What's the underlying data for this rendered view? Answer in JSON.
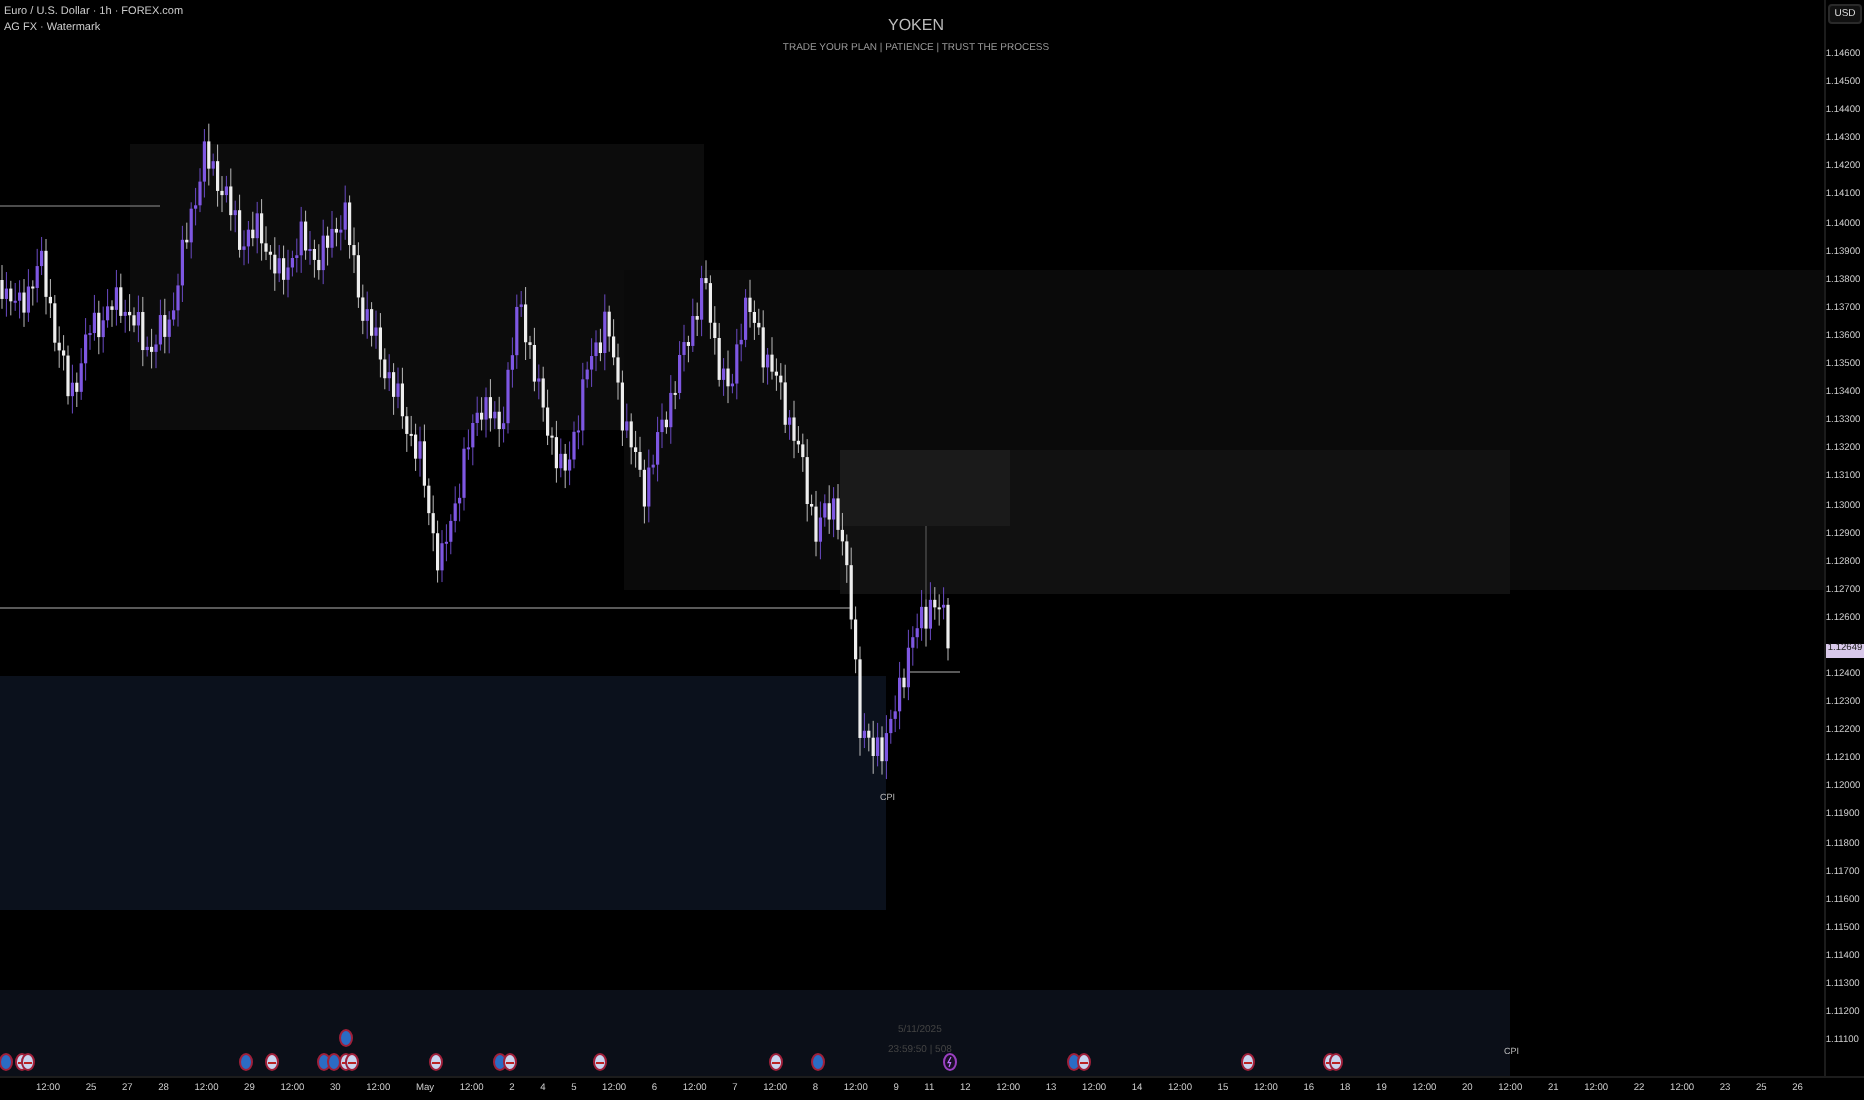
{
  "legend": {
    "symbol": "Euro / U.S. Dollar · 1h · FOREX.com",
    "indicator": "AG FX · Watermark"
  },
  "watermark": {
    "title": "YOKEN",
    "subtitle": "TRADE YOUR PLAN | PATIENCE | TRUST THE PROCESS"
  },
  "currency_button": "USD",
  "price_axis": [
    {
      "text": "1.14600",
      "kind": "tick"
    },
    {
      "text": "1.14500",
      "kind": "tick"
    },
    {
      "text": "1.14400",
      "kind": "tick"
    },
    {
      "text": "1.14300",
      "kind": "tick"
    },
    {
      "text": "1.14200",
      "kind": "tick"
    },
    {
      "text": "1.14100",
      "kind": "tick"
    },
    {
      "text": "1.14000",
      "kind": "tick"
    },
    {
      "text": "1.13900",
      "kind": "tick"
    },
    {
      "text": "1.13800",
      "kind": "tick"
    },
    {
      "text": "1.13700",
      "kind": "tick"
    },
    {
      "text": "1.13600",
      "kind": "tick"
    },
    {
      "text": "1.13500",
      "kind": "tick"
    },
    {
      "text": "1.13400",
      "kind": "tick"
    },
    {
      "text": "1.13300",
      "kind": "tick"
    },
    {
      "text": "1.13200",
      "kind": "tick"
    },
    {
      "text": "1.13100",
      "kind": "tick"
    },
    {
      "text": "1.13000",
      "kind": "tick"
    },
    {
      "text": "1.12900",
      "kind": "tick"
    },
    {
      "text": "1.12800",
      "kind": "tick"
    },
    {
      "text": "1.12700",
      "kind": "tick"
    },
    {
      "text": "1.12600",
      "kind": "tick"
    },
    {
      "text": "1.12649",
      "kind": "current"
    },
    {
      "text": "1.12400",
      "kind": "tick"
    },
    {
      "text": "1.12300",
      "kind": "tick"
    },
    {
      "text": "1.12200",
      "kind": "tick"
    },
    {
      "text": "1.12100",
      "kind": "tick"
    },
    {
      "text": "1.12000",
      "kind": "tick"
    },
    {
      "text": "1.11900",
      "kind": "tick"
    },
    {
      "text": "1.11800",
      "kind": "tick"
    },
    {
      "text": "1.11700",
      "kind": "tick"
    },
    {
      "text": "1.11600",
      "kind": "tick"
    },
    {
      "text": "1.11500",
      "kind": "tick"
    },
    {
      "text": "1.11400",
      "kind": "tick"
    },
    {
      "text": "1.11300",
      "kind": "tick"
    },
    {
      "text": "1.11200",
      "kind": "tick"
    },
    {
      "text": "1.11100",
      "kind": "tick"
    }
  ],
  "time_axis": [
    "12:00",
    "25",
    "27",
    "28",
    "12:00",
    "29",
    "12:00",
    "30",
    "12:00",
    "May",
    "12:00",
    "2",
    "4",
    "5",
    "12:00",
    "6",
    "12:00",
    "7",
    "12:00",
    "8",
    "12:00",
    "9",
    "11",
    "12",
    "12:00",
    "13",
    "12:00",
    "14",
    "12:00",
    "15",
    "12:00",
    "16",
    "18",
    "19",
    "12:00",
    "20",
    "12:00",
    "21",
    "12:00",
    "22",
    "12:00",
    "23",
    "25",
    "26"
  ],
  "markers": [
    "CPI",
    "CPI"
  ],
  "event_info": {
    "date": "5/11/2025",
    "time": "23:59:50 | 508"
  }
}
